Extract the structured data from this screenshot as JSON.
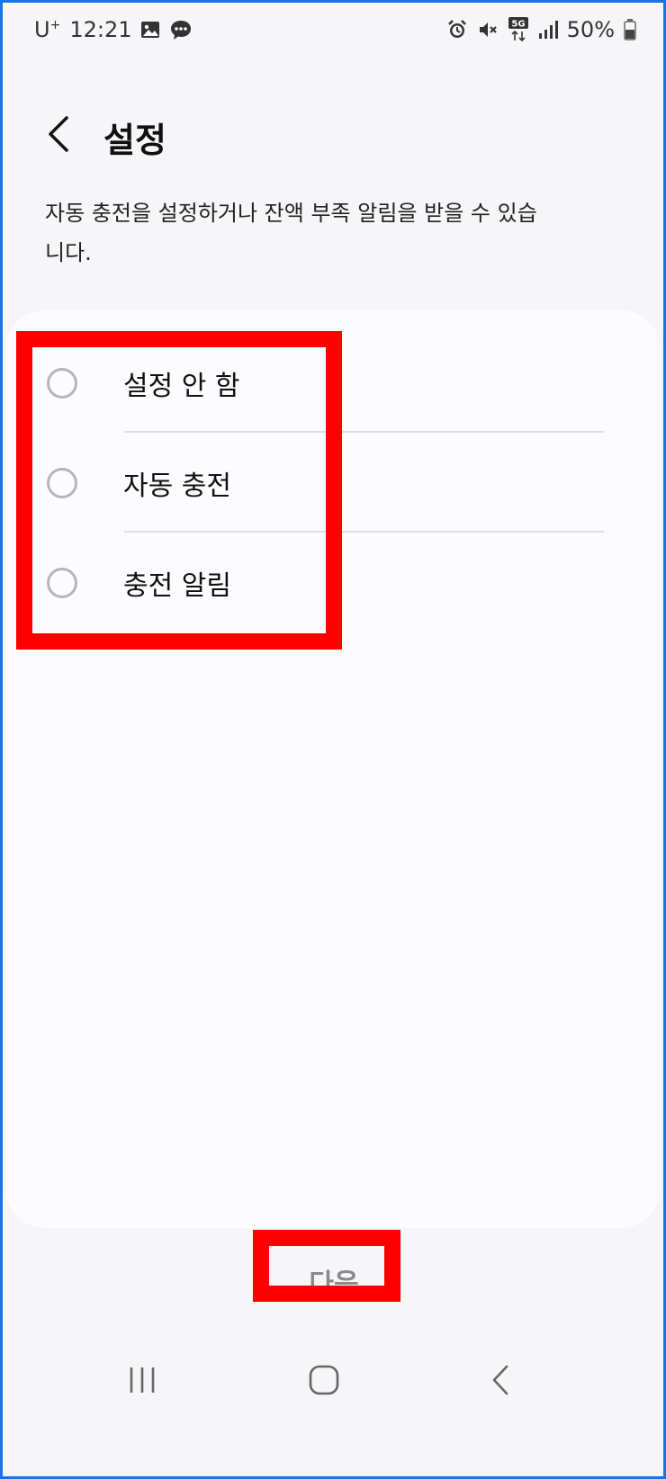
{
  "status_bar": {
    "carrier": "U",
    "carrier_sup": "+",
    "time": "12:21",
    "left_icons": [
      "gallery-icon",
      "chat-bubble-icon"
    ],
    "right_icons": [
      "alarm-icon",
      "mute-icon",
      "5g-icon",
      "signal-icon",
      "battery-icon"
    ],
    "network_label": "5G",
    "battery": "50%"
  },
  "header": {
    "back_icon": "chevron-left-icon",
    "title": "설정"
  },
  "description": "자동 충전을 설정하거나 잔액 부족 알림을 받을 수 있습니다.",
  "options": [
    {
      "label": "설정 안 함",
      "selected": false
    },
    {
      "label": "자동 충전",
      "selected": false
    },
    {
      "label": "충전 알림",
      "selected": false
    }
  ],
  "next_button": {
    "label": "다음",
    "enabled": false
  },
  "nav_bar": {
    "icons": [
      "recent-apps-icon",
      "home-icon",
      "back-icon"
    ]
  },
  "colors": {
    "annotation": "#ff0000",
    "background": "#f6f6f8",
    "card": "#fcfcff",
    "radio_border": "#b6b6b8",
    "disabled_text": "#8a8a8c"
  }
}
